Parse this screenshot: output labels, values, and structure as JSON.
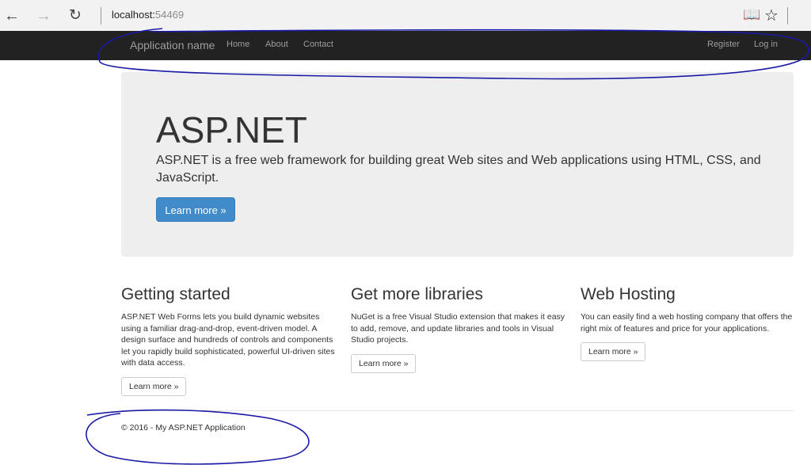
{
  "browser": {
    "address_host": "localhost:",
    "address_port": "54469"
  },
  "navbar": {
    "brand": "Application name",
    "links": [
      "Home",
      "About",
      "Contact"
    ],
    "right_links": [
      "Register",
      "Log in"
    ]
  },
  "jumbotron": {
    "title": "ASP.NET",
    "lead": "ASP.NET is a free web framework for building great Web sites and Web applications using HTML, CSS, and JavaScript.",
    "button": "Learn more »"
  },
  "columns": [
    {
      "title": "Getting started",
      "text": "ASP.NET Web Forms lets you build dynamic websites using a familiar drag-and-drop, event-driven model. A design surface and hundreds of controls and components let you rapidly build sophisticated, powerful UI-driven sites with data access.",
      "button": "Learn more »"
    },
    {
      "title": "Get more libraries",
      "text": "NuGet is a free Visual Studio extension that makes it easy to add, remove, and update libraries and tools in Visual Studio projects.",
      "button": "Learn more »"
    },
    {
      "title": "Web Hosting",
      "text": "You can easily find a web hosting company that offers the right mix of features and price for your applications.",
      "button": "Learn more »"
    }
  ],
  "footer": {
    "text": "© 2016 - My ASP.NET Application"
  },
  "annotation_color": "#1a1aa6",
  "navbar_color": "#222222",
  "primary_color": "#428bca"
}
